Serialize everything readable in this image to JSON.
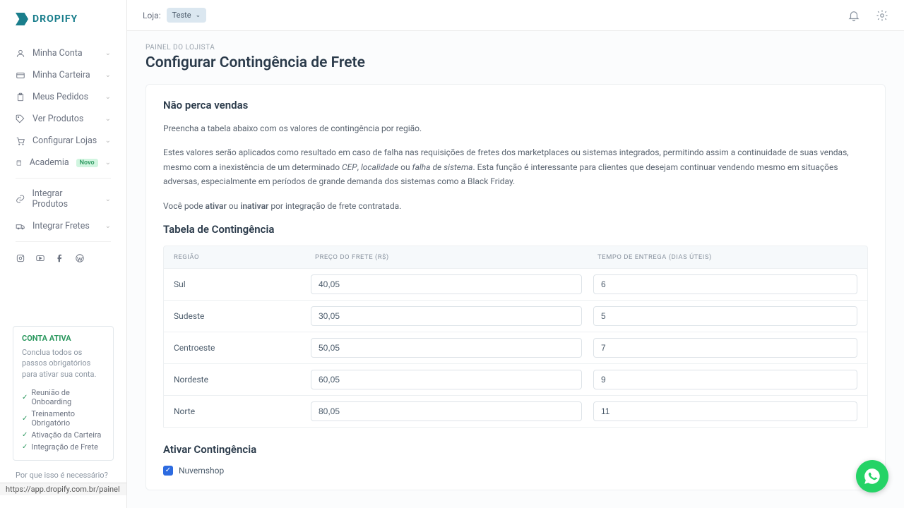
{
  "brand": "DROPIFY",
  "topbar": {
    "store_label": "Loja:",
    "store_value": "Teste"
  },
  "sidebar": {
    "items": [
      {
        "label": "Minha Conta"
      },
      {
        "label": "Minha Carteira"
      },
      {
        "label": "Meus Pedidos"
      },
      {
        "label": "Ver Produtos"
      },
      {
        "label": "Configurar Lojas"
      },
      {
        "label": "Academia",
        "badge": "Novo"
      }
    ],
    "integrations": [
      {
        "label": "Integrar Produtos"
      },
      {
        "label": "Integrar Fretes"
      }
    ]
  },
  "account_box": {
    "title": "CONTA ATIVA",
    "desc": "Conclua todos os passos obrigatórios para ativar sua conta.",
    "steps": [
      "Reunião de Onboarding",
      "Treinamento Obrigatório",
      "Ativação da Carteira",
      "Integração de Frete"
    ],
    "why": "Por que isso é necessário?"
  },
  "urlbar": "https://app.dropify.com.br/painel",
  "page": {
    "breadcrumb": "PAINEL DO LOJISTA",
    "title": "Configurar Contingência de Frete",
    "section1_title": "Não perca vendas",
    "p1": "Preencha a tabela abaixo com os valores de contingência por região.",
    "p2a": "Estes valores serão aplicados como resultado em caso de falha nas requisições de fretes dos marketplaces ou sistemas integrados, permitindo assim a continuidade de suas vendas, mesmo com a inexistência de um determinado ",
    "p2b": "CEP",
    "p2c": ", ",
    "p2d": "localidade",
    "p2e": " ou ",
    "p2f": "falha de sistema",
    "p2g": ". Esta função é interessante para clientes que desejam continuar vendendo mesmo em situações adversas, especialmente em períodos de grande demanda dos sistemas como a Black Friday.",
    "p3a": "Você pode ",
    "p3b": "ativar",
    "p3c": " ou ",
    "p3d": "inativar",
    "p3e": " por integração de frete contratada.",
    "table_title": "Tabela de Contingência",
    "headers": {
      "region": "REGIÃO",
      "price": "PREÇO DO FRETE (R$)",
      "time": "TEMPO DE ENTREGA (DIAS ÚTEIS)"
    },
    "rows": [
      {
        "region": "Sul",
        "price": "40,05",
        "time": "6"
      },
      {
        "region": "Sudeste",
        "price": "30,05",
        "time": "5"
      },
      {
        "region": "Centroeste",
        "price": "50,05",
        "time": "7"
      },
      {
        "region": "Nordeste",
        "price": "60,05",
        "time": "9"
      },
      {
        "region": "Norte",
        "price": "80,05",
        "time": "11"
      }
    ],
    "activate_title": "Ativar Contingência",
    "activate_item": "Nuvemshop"
  }
}
